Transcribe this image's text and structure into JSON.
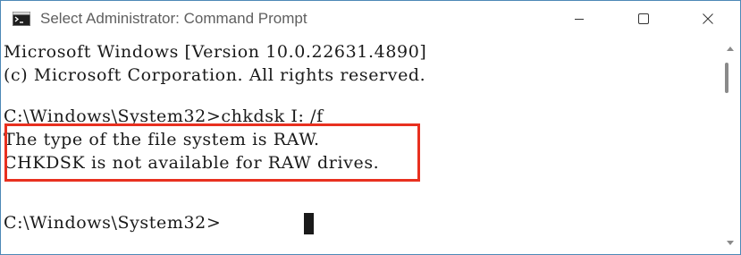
{
  "window": {
    "title": "Select Administrator: Command Prompt",
    "icon": "cmd-icon",
    "controls": {
      "minimize": "minimize-icon",
      "maximize": "maximize-icon",
      "close": "close-icon"
    },
    "border_color": "#4d88b7"
  },
  "terminal": {
    "lines": [
      "Microsoft Windows [Version 10.0.22631.4890]",
      "(c) Microsoft Corporation. All rights reserved.",
      "",
      "C:\\Windows\\System32>chkdsk I: /f",
      "The type of the file system is RAW.",
      "CHKDSK is not available for RAW drives.",
      "",
      "",
      "C:\\Windows\\System32>"
    ],
    "highlight_color": "#e8301f"
  }
}
